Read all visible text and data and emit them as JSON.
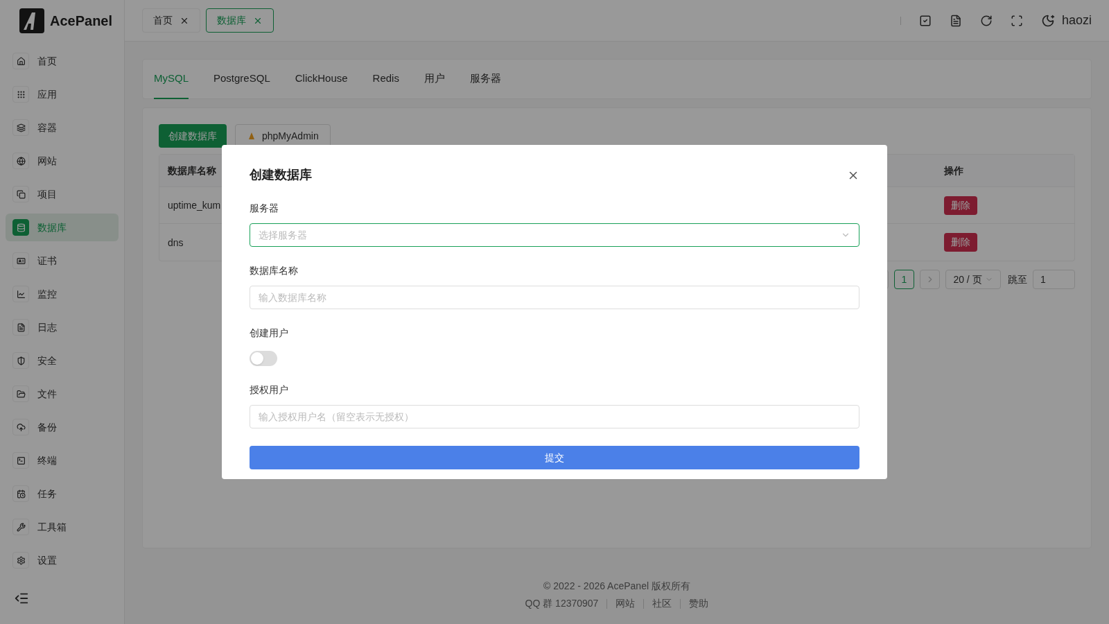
{
  "brand": "AcePanel",
  "sidebar": {
    "items": [
      {
        "label": "首页",
        "selected": false
      },
      {
        "label": "应用",
        "selected": false
      },
      {
        "label": "容器",
        "selected": false
      },
      {
        "label": "网站",
        "selected": false
      },
      {
        "label": "项目",
        "selected": false
      },
      {
        "label": "数据库",
        "selected": true
      },
      {
        "label": "证书",
        "selected": false
      },
      {
        "label": "监控",
        "selected": false
      },
      {
        "label": "日志",
        "selected": false
      },
      {
        "label": "安全",
        "selected": false
      },
      {
        "label": "文件",
        "selected": false
      },
      {
        "label": "备份",
        "selected": false
      },
      {
        "label": "终端",
        "selected": false
      },
      {
        "label": "任务",
        "selected": false
      },
      {
        "label": "工具箱",
        "selected": false
      },
      {
        "label": "设置",
        "selected": false
      }
    ]
  },
  "header": {
    "tabs": [
      {
        "label": "首页",
        "selected": false
      },
      {
        "label": "数据库",
        "selected": true
      }
    ],
    "user": "haozi"
  },
  "db_tabs": [
    {
      "label": "MySQL",
      "selected": true
    },
    {
      "label": "PostgreSQL",
      "selected": false
    },
    {
      "label": "ClickHouse",
      "selected": false
    },
    {
      "label": "Redis",
      "selected": false
    },
    {
      "label": "用户",
      "selected": false
    },
    {
      "label": "服务器",
      "selected": false
    }
  ],
  "toolbar": {
    "create_button": "创建数据库",
    "phpmyadmin_button": "phpMyAdmin"
  },
  "table": {
    "columns": [
      "数据库名称",
      "操作"
    ],
    "rows": [
      {
        "name": "uptime_kum",
        "action": "删除"
      },
      {
        "name": "dns",
        "action": "删除"
      }
    ]
  },
  "pagination": {
    "page": "1",
    "page_size": "20 / 页",
    "jump_label": "跳至",
    "jump_value": "1"
  },
  "footer": {
    "copyright": "© 2022 - 2026 AcePanel 版权所有",
    "links": [
      "QQ 群 12370907",
      "网站",
      "社区",
      "赞助"
    ]
  },
  "dialog": {
    "title": "创建数据库",
    "fields": [
      {
        "kind": "select",
        "label": "服务器",
        "placeholder": "选择服务器",
        "focused": true
      },
      {
        "kind": "input",
        "label": "数据库名称",
        "placeholder": "输入数据库名称",
        "focused": false
      },
      {
        "kind": "switch",
        "label": "创建用户",
        "on": false
      },
      {
        "kind": "input",
        "label": "授权用户",
        "placeholder": "输入授权用户名（留空表示无授权）",
        "focused": false
      }
    ],
    "submit": "提交"
  }
}
